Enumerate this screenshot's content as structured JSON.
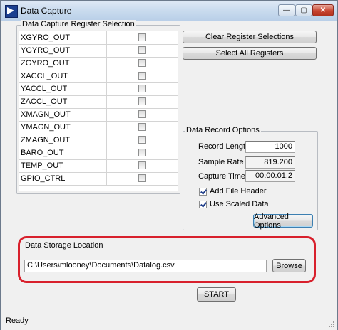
{
  "window": {
    "title": "Data Capture",
    "controls": {
      "minimize": "—",
      "maximize": "▢",
      "close": "✕"
    }
  },
  "register_selection": {
    "title": "Data Capture Register Selection",
    "registers": [
      {
        "name": "XGYRO_OUT",
        "checked": false
      },
      {
        "name": "YGYRO_OUT",
        "checked": false
      },
      {
        "name": "ZGYRO_OUT",
        "checked": false
      },
      {
        "name": "XACCL_OUT",
        "checked": false
      },
      {
        "name": "YACCL_OUT",
        "checked": false
      },
      {
        "name": "ZACCL_OUT",
        "checked": false
      },
      {
        "name": "XMAGN_OUT",
        "checked": false
      },
      {
        "name": "YMAGN_OUT",
        "checked": false
      },
      {
        "name": "ZMAGN_OUT",
        "checked": false
      },
      {
        "name": "BARO_OUT",
        "checked": false
      },
      {
        "name": "TEMP_OUT",
        "checked": false
      },
      {
        "name": "GPIO_CTRL",
        "checked": false
      }
    ],
    "clear_button": "Clear Register Selections",
    "select_all_button": "Select All Registers"
  },
  "record_options": {
    "title": "Data Record Options",
    "record_length_label": "Record Length",
    "record_length_value": "1000",
    "sample_rate_label": "Sample Rate",
    "sample_rate_value": "819.200",
    "capture_time_label": "Capture Time",
    "capture_time_value": "00:00:01.2",
    "add_file_header_label": "Add File Header",
    "add_file_header_checked": true,
    "use_scaled_data_label": "Use Scaled Data",
    "use_scaled_data_checked": true,
    "advanced_button": "Advanced Options"
  },
  "storage": {
    "title": "Data Storage Location",
    "path_value": "C:\\Users\\mlooney\\Documents\\Datalog.csv",
    "browse_button": "Browse"
  },
  "start_button": "START",
  "status": "Ready",
  "colors": {
    "highlight": "#d8202c",
    "title_bar": "#c9dbee"
  }
}
